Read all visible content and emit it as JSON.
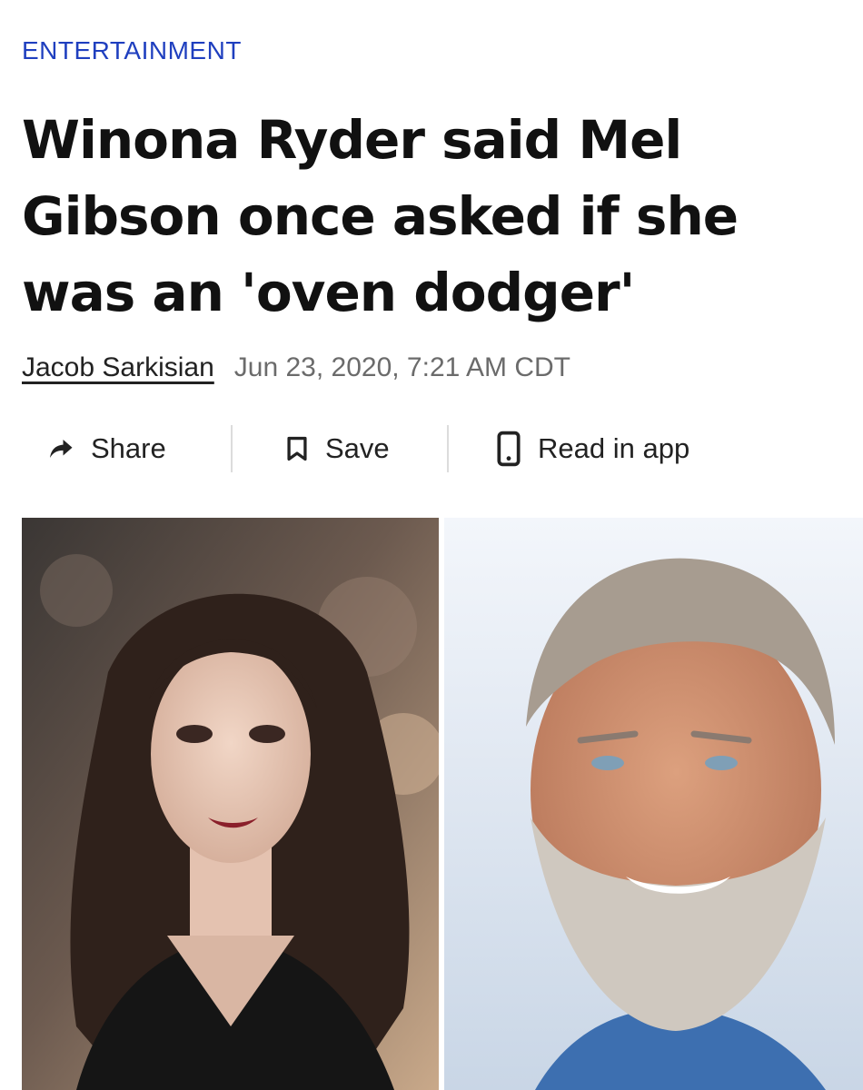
{
  "article": {
    "category": "ENTERTAINMENT",
    "headline": "Winona Ryder said Mel Gibson once asked if she was an 'oven dodger'",
    "author": "Jacob Sarkisian",
    "timestamp": "Jun 23, 2020, 7:21 AM CDT"
  },
  "actions": {
    "share_label": "Share",
    "save_label": "Save",
    "read_in_app_label": "Read in app"
  },
  "icons": {
    "share": "share-arrow-icon",
    "save": "bookmark-icon",
    "read_in_app": "phone-icon"
  },
  "colors": {
    "category": "#1f3fbf",
    "headline": "#111111",
    "timestamp": "#6b6b6b"
  }
}
